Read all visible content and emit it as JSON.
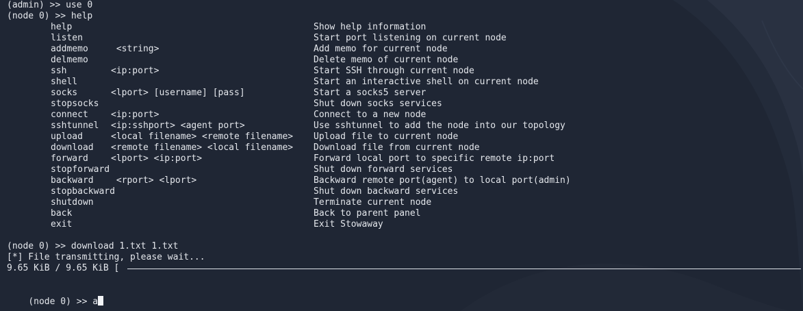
{
  "history": {
    "line1": "(admin) >> use 0",
    "line2": "(node 0) >> help"
  },
  "help_commands": [
    {
      "name": "help",
      "args": "",
      "desc": "Show help information"
    },
    {
      "name": "listen",
      "args": "",
      "desc": "Start port listening on current node"
    },
    {
      "name": "addmemo",
      "args": " <string>",
      "desc": "Add memo for current node"
    },
    {
      "name": "delmemo",
      "args": "",
      "desc": "Delete memo of current node"
    },
    {
      "name": "ssh",
      "args": "<ip:port>",
      "desc": "Start SSH through current node"
    },
    {
      "name": "shell",
      "args": "",
      "desc": "Start an interactive shell on current node"
    },
    {
      "name": "socks",
      "args": "<lport> [username] [pass]",
      "desc": "Start a socks5 server"
    },
    {
      "name": "stopsocks",
      "args": "",
      "desc": "Shut down socks services"
    },
    {
      "name": "connect",
      "args": "<ip:port>",
      "desc": "Connect to a new node"
    },
    {
      "name": "sshtunnel",
      "args": "<ip:sshport> <agent port>",
      "desc": "Use sshtunnel to add the node into our topology"
    },
    {
      "name": "upload",
      "args": "<local filename> <remote filename>",
      "desc": "Upload file to current node"
    },
    {
      "name": "download",
      "args": "<remote filename> <local filename>",
      "desc": "Download file from current node"
    },
    {
      "name": "forward",
      "args": "<lport> <ip:port>",
      "desc": "Forward local port to specific remote ip:port"
    },
    {
      "name": "stopforward",
      "args": "",
      "desc": "Shut down forward services"
    },
    {
      "name": "backward",
      "args": " <rport> <lport>",
      "desc": "Backward remote port(agent) to local port(admin)"
    },
    {
      "name": "stopbackward",
      "args": "",
      "desc": "Shut down backward services"
    },
    {
      "name": "shutdown",
      "args": "",
      "desc": "Terminate current node"
    },
    {
      "name": "back",
      "args": "",
      "desc": "Back to parent panel"
    },
    {
      "name": "exit",
      "args": "",
      "desc": "Exit Stowaway"
    }
  ],
  "download": {
    "command": "(node 0) >> download 1.txt 1.txt",
    "status": "[*] File transmitting, please wait...",
    "progress_text": "9.65 KiB / 9.65 KiB [",
    "progress_fraction": 1.0
  },
  "prompt": {
    "text": "(node 0) >> ",
    "input_value": "a"
  }
}
